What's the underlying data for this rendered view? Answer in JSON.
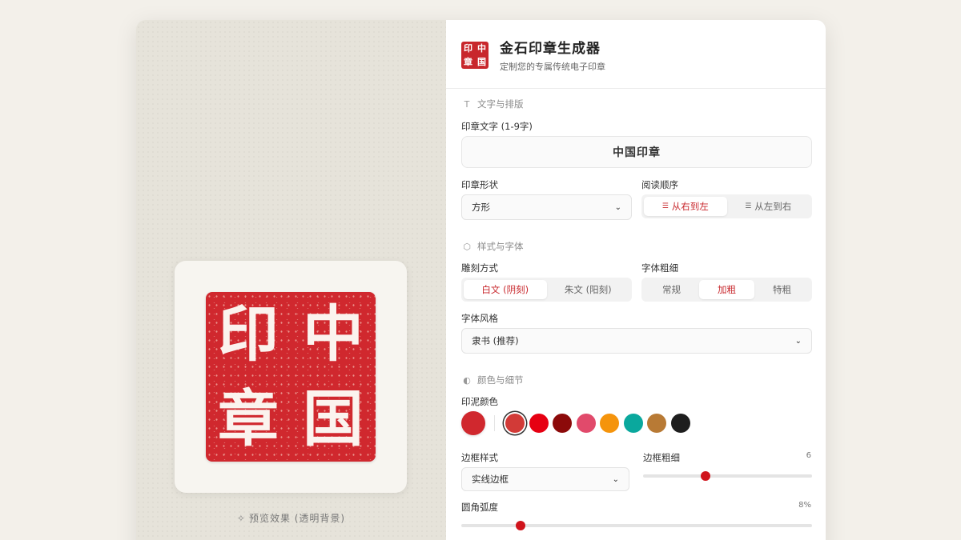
{
  "app": {
    "title": "金石印章生成器",
    "subtitle": "定制您的专属传统电子印章",
    "logo_chars": [
      "印",
      "中",
      "章",
      "国"
    ]
  },
  "preview": {
    "seal_chars": [
      "印",
      "中",
      "章",
      "国"
    ],
    "caption": "预览效果 (透明背景)",
    "seal_color": "#d0282e"
  },
  "sections": {
    "text": "文字与排版",
    "style": "样式与字体",
    "color": "颜色与细节"
  },
  "text_field": {
    "label": "印章文字 (1-9字)",
    "value": "中国印章"
  },
  "shape": {
    "label": "印章形状",
    "value": "方形"
  },
  "reading_order": {
    "label": "阅读顺序",
    "options": [
      "从右到左",
      "从左到右"
    ],
    "active": 0
  },
  "carving": {
    "label": "雕刻方式",
    "options": [
      "白文 (阴刻)",
      "朱文 (阳刻)"
    ],
    "active": 0
  },
  "weight": {
    "label": "字体粗细",
    "options": [
      "常规",
      "加粗",
      "特粗"
    ],
    "active": 1
  },
  "font_style": {
    "label": "字体风格",
    "value": "隶书 (推荐)"
  },
  "ink_color": {
    "label": "印泥颜色",
    "current": "#d0282e",
    "swatches": [
      "#d23a37",
      "#e60012",
      "#8c0a0a",
      "#e14a6b",
      "#f5940c",
      "#0aa89d",
      "#b87a35",
      "#1e1e1e"
    ],
    "selected": 0
  },
  "border_style": {
    "label": "边框样式",
    "value": "实线边框"
  },
  "border_width": {
    "label": "边框粗细",
    "value": "6",
    "fraction": 0.37
  },
  "corner_radius": {
    "label": "圆角弧度",
    "value": "8%",
    "fraction": 0.168
  }
}
